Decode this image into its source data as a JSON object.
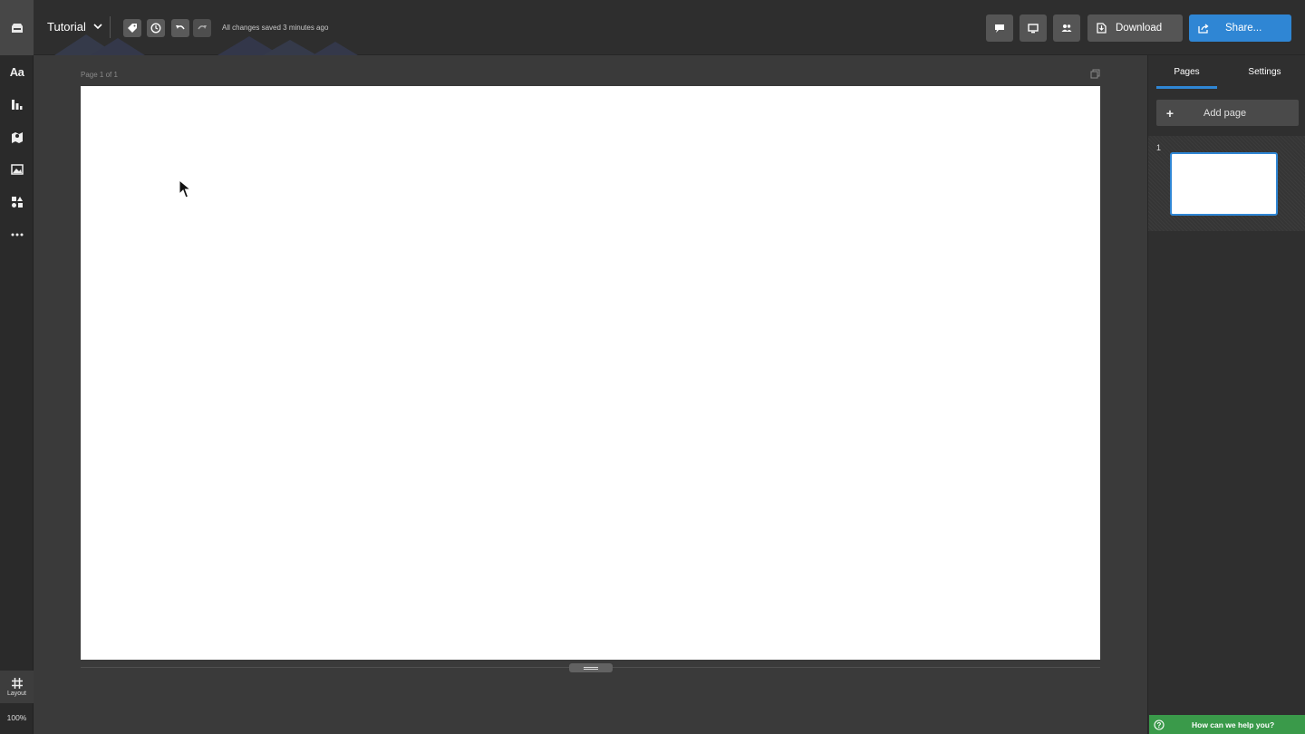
{
  "app": {
    "doc_title": "Tutorial",
    "save_status": "All changes saved 3 minutes ago"
  },
  "toolbar": {
    "tools": [
      "tag-icon",
      "history-icon",
      "undo-icon",
      "redo-icon"
    ],
    "right_icons": [
      "comment-icon",
      "present-icon",
      "collaborators-icon"
    ],
    "download_label": "Download",
    "share_label": "Share..."
  },
  "leftbar": {
    "items": [
      {
        "name": "text-tool",
        "label": "Aa"
      },
      {
        "name": "charts-tool",
        "icon": "bar-chart-icon"
      },
      {
        "name": "maps-tool",
        "icon": "map-icon"
      },
      {
        "name": "images-tool",
        "icon": "image-icon"
      },
      {
        "name": "shapes-tool",
        "icon": "shapes-icon"
      },
      {
        "name": "more-tool",
        "icon": "more-icon"
      }
    ],
    "layout_label": "Layout",
    "zoom": "100%"
  },
  "canvas": {
    "page_label": "Page 1 of 1"
  },
  "panel": {
    "tabs": [
      "Pages",
      "Settings"
    ],
    "active_tab": "Pages",
    "add_page_label": "Add page",
    "pages": [
      {
        "number": "1"
      }
    ]
  },
  "help": {
    "label": "How can we help you?"
  },
  "colors": {
    "accent": "#2f86d4",
    "help_green": "#3a9a4a"
  }
}
